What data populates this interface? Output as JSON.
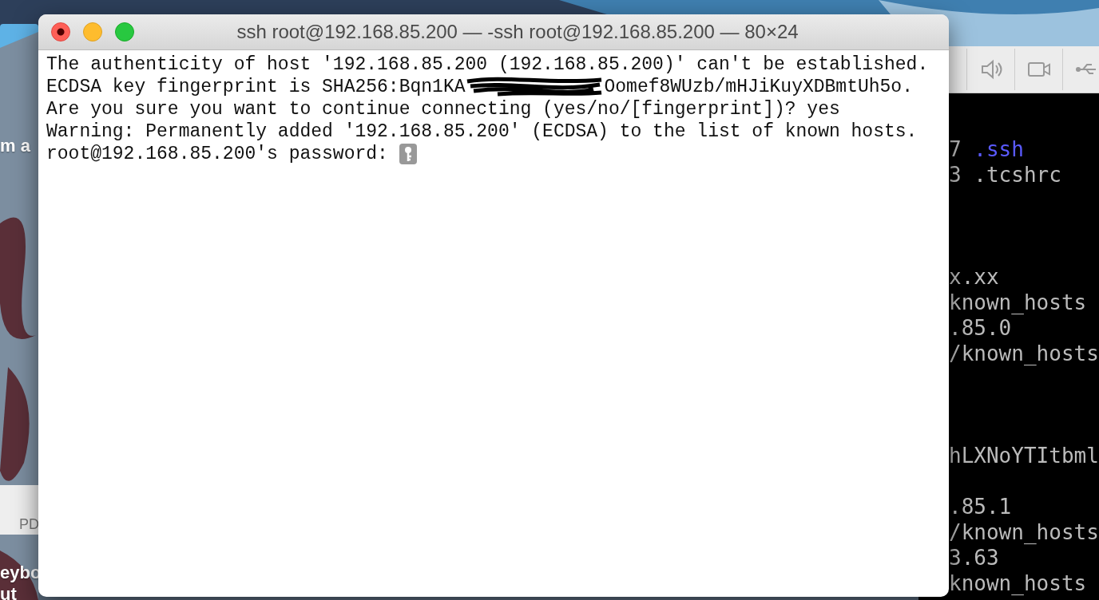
{
  "desktop": {
    "labels": [
      {
        "text": "m a",
        "kind": "label"
      },
      {
        "text": "PD",
        "kind": "document"
      },
      {
        "text": "eybo",
        "kind": "label"
      },
      {
        "text": "ut",
        "kind": "label"
      }
    ]
  },
  "vm_window": {
    "toolbar": [
      {
        "kind": "speaker"
      },
      {
        "kind": "camera"
      },
      {
        "kind": "usb"
      }
    ],
    "console_lines": [
      {
        "kind": "text",
        "parts": [
          {
            "text": "7 "
          },
          {
            "text": ".ssh",
            "color": "#5a5aff"
          }
        ]
      },
      {
        "kind": "text",
        "parts": [
          {
            "text": "3 .tcshrc"
          }
        ]
      },
      {
        "kind": "blank"
      },
      {
        "kind": "blank"
      },
      {
        "kind": "blank"
      },
      {
        "kind": "text",
        "parts": [
          {
            "text": "x.xx"
          }
        ]
      },
      {
        "kind": "text",
        "parts": [
          {
            "text": "known_hosts"
          }
        ]
      },
      {
        "kind": "text",
        "parts": [
          {
            "text": ".85.0"
          }
        ]
      },
      {
        "kind": "text",
        "parts": [
          {
            "text": "/known_hosts"
          }
        ]
      },
      {
        "kind": "blank"
      },
      {
        "kind": "blank"
      },
      {
        "kind": "blank"
      },
      {
        "kind": "text",
        "parts": [
          {
            "text": "hLXNoYTItbml"
          }
        ]
      },
      {
        "kind": "blank"
      },
      {
        "kind": "text",
        "parts": [
          {
            "text": ".85.1"
          }
        ]
      },
      {
        "kind": "text",
        "parts": [
          {
            "text": "/known_hosts"
          }
        ]
      },
      {
        "kind": "text",
        "parts": [
          {
            "text": "3.63"
          }
        ]
      },
      {
        "kind": "text",
        "parts": [
          {
            "text": "known_hosts"
          }
        ]
      }
    ]
  },
  "terminal": {
    "title": "ssh root@192.168.85.200 — -ssh root@192.168.85.200 — 80×24",
    "lines": [
      {
        "kind": "text",
        "text": "The authenticity of host '192.168.85.200 (192.168.85.200)' can't be established."
      },
      {
        "kind": "redacted",
        "before": "ECDSA key fingerprint is SHA256:Bqn1KA",
        "after": "Oomef8WUzb/mHJiKuyXDBmtUh5o."
      },
      {
        "kind": "text",
        "text": "Are you sure you want to continue connecting (yes/no/[fingerprint])? yes"
      },
      {
        "kind": "text",
        "text": "Warning: Permanently added '192.168.85.200' (ECDSA) to the list of known hosts."
      },
      {
        "kind": "prompt",
        "text": "root@192.168.85.200's password:"
      }
    ]
  }
}
